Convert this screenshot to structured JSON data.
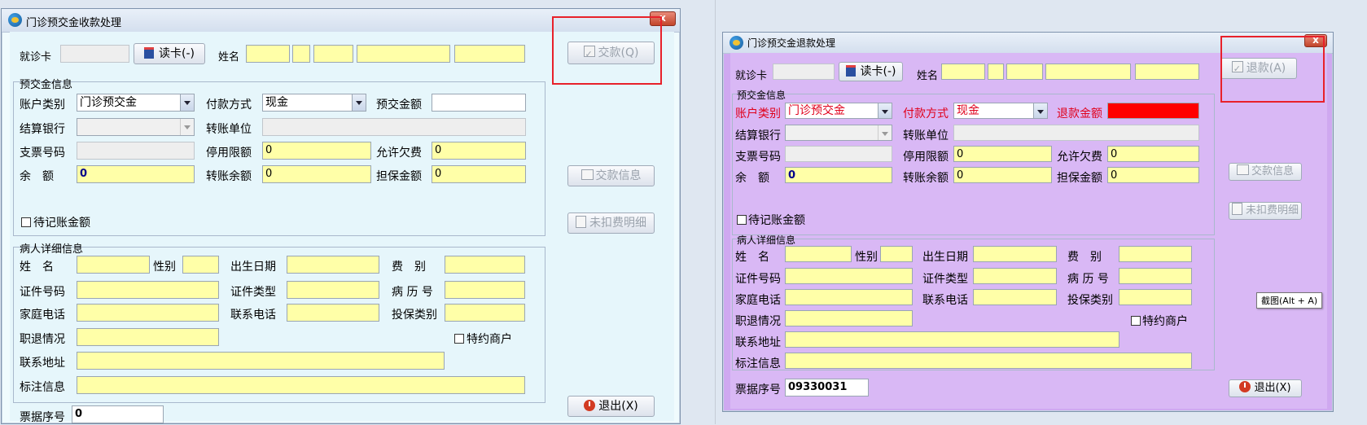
{
  "left": {
    "title": "门诊预交金收款处理",
    "close": "x",
    "card_label": "就诊卡",
    "read_card": "读卡(-)",
    "name_label": "姓名",
    "section_prepay": "预交金信息",
    "account_type_label": "账户类别",
    "account_type_value": "门诊预交金",
    "pay_method_label": "付款方式",
    "pay_method_value": "现金",
    "amount_label": "预交金额",
    "bank_label": "结算银行",
    "transfer_unit_label": "转账单位",
    "check_no_label": "支票号码",
    "stop_limit_label": "停用限额",
    "stop_limit_value": "0",
    "allow_owe_label": "允许欠费",
    "allow_owe_value": "0",
    "balance_label": "余　额",
    "balance_value": "0",
    "transfer_balance_label": "转账余额",
    "transfer_balance_value": "0",
    "guarantee_label": "担保金额",
    "guarantee_value": "0",
    "pending_label": "待记账金额",
    "section_patient": "病人详细信息",
    "pname_label": "姓　名",
    "gender_label": "性别",
    "birth_label": "出生日期",
    "fee_label": "费　别",
    "id_no_label": "证件号码",
    "id_type_label": "证件类型",
    "record_label": "病 历 号",
    "home_phone_label": "家庭电话",
    "contact_phone_label": "联系电话",
    "insurance_label": "投保类别",
    "job_label": "职退情况",
    "merchant_label": "特约商户",
    "address_label": "联系地址",
    "note_label": "标注信息",
    "receipt_label": "票据序号",
    "receipt_value": "0",
    "pay_button": "交款(Q)",
    "pay_info_button": "交款信息",
    "undeducted_button": "未扣费明细",
    "exit_button": "退出(X)"
  },
  "right": {
    "title": "门诊预交金退款处理",
    "close": "x",
    "card_label": "就诊卡",
    "read_card": "读卡(-)",
    "name_label": "姓名",
    "section_prepay": "预交金信息",
    "account_type_label": "账户类别",
    "account_type_value": "门诊预交金",
    "pay_method_label": "付款方式",
    "pay_method_value": "现金",
    "refund_label": "退款金额",
    "bank_label": "结算银行",
    "transfer_unit_label": "转账单位",
    "check_no_label": "支票号码",
    "stop_limit_label": "停用限额",
    "stop_limit_value": "0",
    "allow_owe_label": "允许欠费",
    "allow_owe_value": "0",
    "balance_label": "余　额",
    "balance_value": "0",
    "transfer_balance_label": "转账余额",
    "transfer_balance_value": "0",
    "guarantee_label": "担保金额",
    "guarantee_value": "0",
    "pending_label": "待记账金额",
    "section_patient": "病人详细信息",
    "pname_label": "姓　名",
    "gender_label": "性别",
    "birth_label": "出生日期",
    "fee_label": "费　别",
    "id_no_label": "证件号码",
    "id_type_label": "证件类型",
    "record_label": "病 历 号",
    "home_phone_label": "家庭电话",
    "contact_phone_label": "联系电话",
    "insurance_label": "投保类别",
    "job_label": "职退情况",
    "merchant_label": "特约商户",
    "address_label": "联系地址",
    "note_label": "标注信息",
    "receipt_label": "票据序号",
    "receipt_value": "09330031",
    "refund_button": "退款(A)",
    "pay_info_button": "交款信息",
    "undeducted_button": "未扣费明细",
    "exit_button": "退出(X)",
    "tooltip": "截图(Alt + A)"
  },
  "colors": {
    "left_bg": "#f0fbfd",
    "right_bg": "#d9b8f5",
    "highlight": "#e8212a",
    "field_yellow": "#ffffa8"
  }
}
